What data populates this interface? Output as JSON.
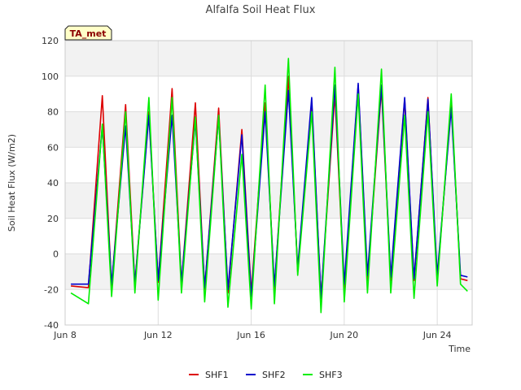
{
  "chart_data": {
    "type": "line",
    "title": "Alfalfa Soil Heat Flux",
    "xlabel": "Time",
    "ylabel": "Soil Heat Flux (W/m2)",
    "ylim": [
      -40,
      120
    ],
    "yticks": [
      -40,
      -20,
      0,
      20,
      40,
      60,
      80,
      100,
      120
    ],
    "xlim_day": [
      8,
      25.5
    ],
    "xticks": [
      {
        "day": 8,
        "label": "Jun 8"
      },
      {
        "day": 12,
        "label": "Jun 12"
      },
      {
        "day": 16,
        "label": "Jun 16"
      },
      {
        "day": 20,
        "label": "Jun 20"
      },
      {
        "day": 24,
        "label": "Jun 24"
      }
    ],
    "grid": true,
    "legend_position": "bottom",
    "annotation": "TA_met",
    "series": [
      {
        "name": "SHF1",
        "color": "#dd0000",
        "days": [
          8.25,
          9.0,
          9.6,
          10.0,
          10.6,
          11.0,
          11.6,
          12.0,
          12.6,
          13.0,
          13.6,
          14.0,
          14.6,
          15.0,
          15.6,
          16.0,
          16.6,
          17.0,
          17.6,
          18.0,
          18.6,
          19.0,
          19.6,
          20.0,
          20.6,
          21.0,
          21.6,
          22.0,
          22.6,
          23.0,
          23.6,
          24.0,
          24.6,
          25.0,
          25.3
        ],
        "values": [
          -18,
          -19,
          89,
          -19,
          84,
          -17,
          80,
          -16,
          93,
          -17,
          85,
          -20,
          82,
          -22,
          70,
          -22,
          85,
          -20,
          100,
          -10,
          85,
          -25,
          90,
          -20,
          95,
          -15,
          93,
          -15,
          87,
          -15,
          88,
          -15,
          85,
          -14,
          -15
        ]
      },
      {
        "name": "SHF2",
        "color": "#0000cc",
        "days": [
          8.25,
          9.0,
          9.6,
          10.0,
          10.6,
          11.0,
          11.6,
          12.0,
          12.6,
          13.0,
          13.6,
          14.0,
          14.6,
          15.0,
          15.6,
          16.0,
          16.6,
          17.0,
          17.6,
          18.0,
          18.6,
          19.0,
          19.6,
          20.0,
          20.6,
          21.0,
          21.6,
          22.0,
          22.6,
          23.0,
          23.6,
          24.0,
          24.6,
          25.0,
          25.3
        ],
        "values": [
          -17,
          -17,
          72,
          -17,
          72,
          -17,
          78,
          -15,
          78,
          -16,
          75,
          -19,
          77,
          -20,
          67,
          -24,
          80,
          -18,
          92,
          -8,
          88,
          -25,
          95,
          -17,
          96,
          -12,
          95,
          -13,
          88,
          -14,
          87,
          -12,
          82,
          -12,
          -13
        ]
      },
      {
        "name": "SHF3",
        "color": "#00ee00",
        "days": [
          8.25,
          9.0,
          9.6,
          10.0,
          10.6,
          11.0,
          11.6,
          12.0,
          12.6,
          13.0,
          13.6,
          14.0,
          14.6,
          15.0,
          15.6,
          16.0,
          16.6,
          17.0,
          17.6,
          18.0,
          18.6,
          19.0,
          19.6,
          20.0,
          20.6,
          21.0,
          21.6,
          22.0,
          22.6,
          23.0,
          23.6,
          24.0,
          24.6,
          25.0,
          25.3
        ],
        "values": [
          -22,
          -28,
          73,
          -24,
          80,
          -22,
          88,
          -26,
          88,
          -22,
          77,
          -27,
          78,
          -30,
          56,
          -31,
          95,
          -28,
          110,
          -12,
          80,
          -33,
          105,
          -27,
          90,
          -22,
          104,
          -22,
          78,
          -25,
          80,
          -18,
          90,
          -17,
          -21
        ]
      }
    ]
  }
}
